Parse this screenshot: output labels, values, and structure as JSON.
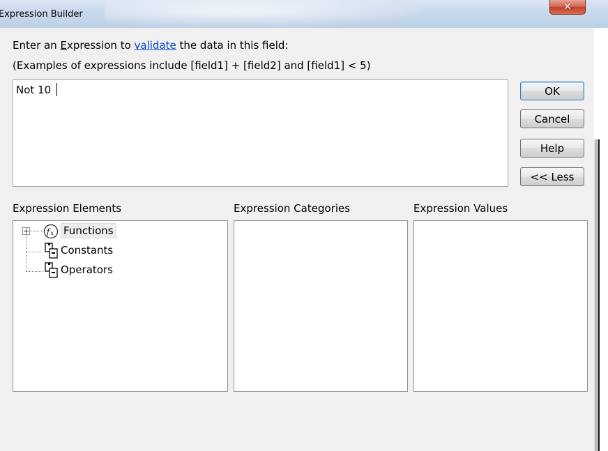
{
  "window": {
    "title": "Expression Builder",
    "close_glyph": "✕"
  },
  "instructions": {
    "line1_pre": "Enter an ",
    "line1_access": "E",
    "line1_mid": "xpression to ",
    "line1_link": "validate",
    "line1_post": " the data in this field:",
    "line2": "(Examples of expressions include [field1] + [field2] and [field1] < 5)"
  },
  "expression": {
    "value": "Not 10"
  },
  "buttons": {
    "ok": "OK",
    "cancel": "Cancel",
    "help": "Help",
    "less": "<< Less"
  },
  "panels": {
    "elements_header": "Expression Elements",
    "categories_header": "Expression Categories",
    "values_header": "Expression Values"
  },
  "tree": [
    {
      "label": "Functions",
      "icon": "function-icon",
      "expandable": true,
      "selected": true
    },
    {
      "label": "Constants",
      "icon": "constants-icon",
      "expandable": false,
      "selected": false
    },
    {
      "label": "Operators",
      "icon": "operators-icon",
      "expandable": false,
      "selected": false
    }
  ]
}
